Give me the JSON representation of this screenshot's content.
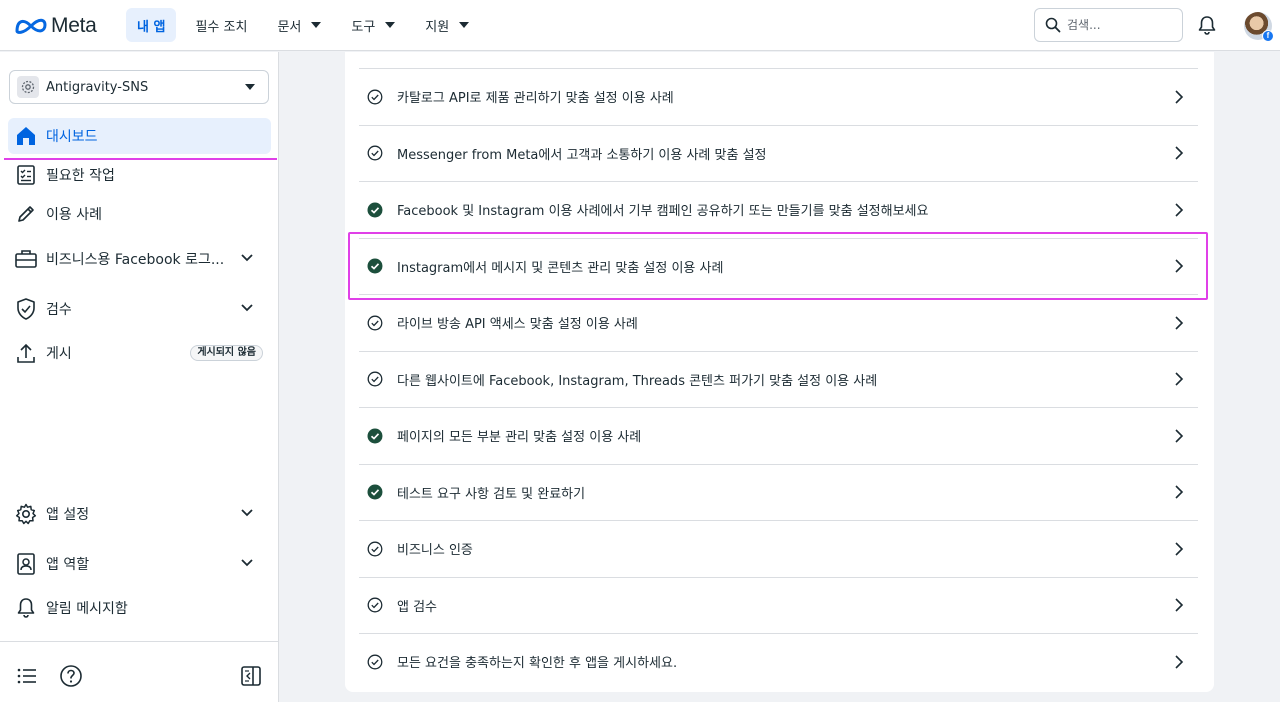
{
  "header": {
    "logo_text": "Meta",
    "nav": [
      {
        "label": "내 앱",
        "active": true,
        "dropdown": false
      },
      {
        "label": "필수 조치",
        "active": false,
        "dropdown": false
      },
      {
        "label": "문서",
        "active": false,
        "dropdown": true
      },
      {
        "label": "도구",
        "active": false,
        "dropdown": true
      },
      {
        "label": "지원",
        "active": false,
        "dropdown": true
      }
    ],
    "search_placeholder": "검색...",
    "icons": {
      "search": "search-icon",
      "notifications": "bell-icon",
      "avatar": "profile-avatar",
      "avatar_badge": "facebook-badge-icon"
    },
    "avatar_badge_glyph": "f"
  },
  "sidebar": {
    "app_name": "Antigravity-SNS",
    "items": [
      {
        "label": "대시보드",
        "icon": "home-icon",
        "active": true
      },
      {
        "label": "필요한 작업",
        "icon": "checklist-icon"
      },
      {
        "label": "이용 사례",
        "icon": "pencil-icon"
      },
      {
        "label": "비즈니스용 Facebook 로그...",
        "icon": "briefcase-icon",
        "expandable": true
      },
      {
        "label": "검수",
        "icon": "shield-check-icon",
        "expandable": true
      },
      {
        "label": "게시",
        "icon": "upload-icon",
        "badge": "게시되지 않음"
      },
      {
        "label": "앱 설정",
        "icon": "gear-icon",
        "expandable": true
      },
      {
        "label": "앱 역할",
        "icon": "user-badge-icon",
        "expandable": true
      },
      {
        "label": "알림 메시지함",
        "icon": "bell-icon"
      }
    ],
    "footer_icons": [
      "list-icon",
      "help-icon",
      "collapse-sidebar-icon"
    ]
  },
  "main": {
    "tasks": [
      {
        "label": "카탈로그 API로 제품 관리하기 맞춤 설정 이용 사례",
        "done": false
      },
      {
        "label": "Messenger from Meta에서 고객과 소통하기 이용 사례 맞춤 설정",
        "done": false
      },
      {
        "label": "Facebook 및 Instagram 이용 사례에서 기부 캠페인 공유하기 또는 만들기를 맞춤 설정해보세요",
        "done": true
      },
      {
        "label": "Instagram에서 메시지 및 콘텐츠 관리 맞춤 설정 이용 사례",
        "done": true,
        "highlighted": true
      },
      {
        "label": "라이브 방송 API 액세스 맞춤 설정 이용 사례",
        "done": false
      },
      {
        "label": "다른 웹사이트에 Facebook, Instagram, Threads 콘텐츠 퍼가기 맞춤 설정 이용 사례",
        "done": false
      },
      {
        "label": "페이지의 모든 부분 관리 맞춤 설정 이용 사례",
        "done": true
      },
      {
        "label": "테스트 요구 사항 검토 및 완료하기",
        "done": true
      },
      {
        "label": "비즈니스 인증",
        "done": false
      },
      {
        "label": "앱 검수",
        "done": false
      },
      {
        "label": "모든 요건을 충족하는지 확인한 후 앱을 게시하세요.",
        "done": false
      }
    ]
  },
  "colors": {
    "accent": "#0064e0",
    "done": "#1c4f3c",
    "highlight": "#e040e8"
  }
}
